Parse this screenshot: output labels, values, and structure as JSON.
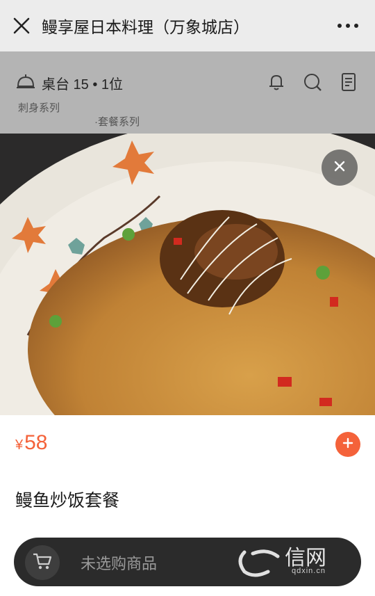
{
  "header": {
    "title": "鳗享屋日本料理（万象城店）"
  },
  "shop": {
    "table_label": "桌台 15 • 1位",
    "categories": [
      "刺身系列",
      "·套餐系列"
    ]
  },
  "dish": {
    "currency": "¥",
    "price": "58",
    "name": "鳗鱼炒饭套餐"
  },
  "cart": {
    "status": "未选购商品"
  },
  "watermark": {
    "brand": "信网",
    "site": "qdxin.cn"
  },
  "colors": {
    "accent": "#f4623a",
    "cart_bar": "#2b2b2b",
    "topbar": "#ececec"
  }
}
